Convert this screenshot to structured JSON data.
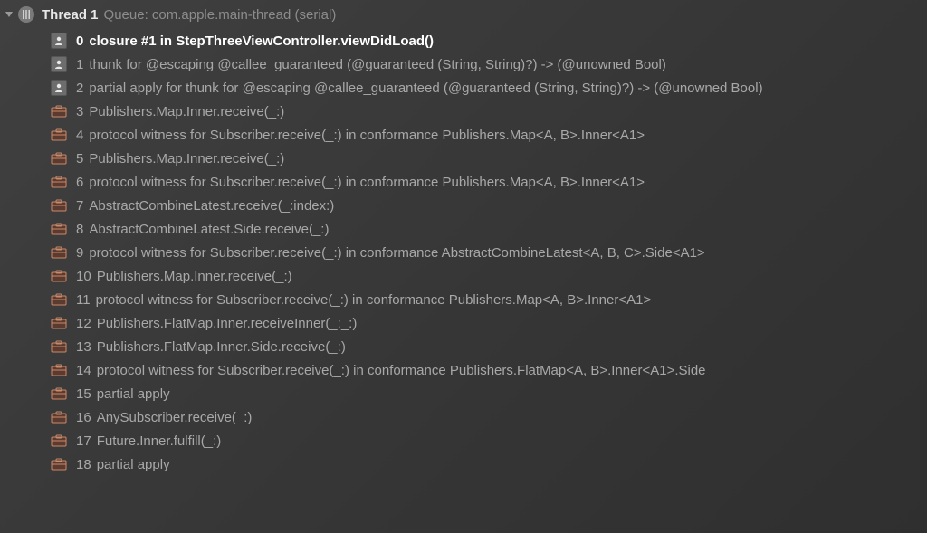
{
  "thread": {
    "title": "Thread 1",
    "queue": "Queue: com.apple.main-thread (serial)"
  },
  "frames": [
    {
      "num": "0",
      "label": "closure #1 in StepThreeViewController.viewDidLoad()",
      "icon": "person",
      "selected": true
    },
    {
      "num": "1",
      "label": "thunk for @escaping @callee_guaranteed (@guaranteed (String, String)?) -> (@unowned Bool)",
      "icon": "person",
      "selected": false
    },
    {
      "num": "2",
      "label": "partial apply for thunk for @escaping @callee_guaranteed (@guaranteed (String, String)?) -> (@unowned Bool)",
      "icon": "person",
      "selected": false
    },
    {
      "num": "3",
      "label": "Publishers.Map.Inner.receive(_:)",
      "icon": "briefcase",
      "selected": false
    },
    {
      "num": "4",
      "label": "protocol witness for Subscriber.receive(_:) in conformance Publishers.Map<A, B>.Inner<A1>",
      "icon": "briefcase",
      "selected": false
    },
    {
      "num": "5",
      "label": "Publishers.Map.Inner.receive(_:)",
      "icon": "briefcase",
      "selected": false
    },
    {
      "num": "6",
      "label": "protocol witness for Subscriber.receive(_:) in conformance Publishers.Map<A, B>.Inner<A1>",
      "icon": "briefcase",
      "selected": false
    },
    {
      "num": "7",
      "label": "AbstractCombineLatest.receive(_:index:)",
      "icon": "briefcase",
      "selected": false
    },
    {
      "num": "8",
      "label": "AbstractCombineLatest.Side.receive(_:)",
      "icon": "briefcase",
      "selected": false
    },
    {
      "num": "9",
      "label": "protocol witness for Subscriber.receive(_:) in conformance AbstractCombineLatest<A, B, C>.Side<A1>",
      "icon": "briefcase",
      "selected": false
    },
    {
      "num": "10",
      "label": "Publishers.Map.Inner.receive(_:)",
      "icon": "briefcase",
      "selected": false
    },
    {
      "num": "11",
      "label": "protocol witness for Subscriber.receive(_:) in conformance Publishers.Map<A, B>.Inner<A1>",
      "icon": "briefcase",
      "selected": false
    },
    {
      "num": "12",
      "label": "Publishers.FlatMap.Inner.receiveInner(_:_:)",
      "icon": "briefcase",
      "selected": false
    },
    {
      "num": "13",
      "label": "Publishers.FlatMap.Inner.Side.receive(_:)",
      "icon": "briefcase",
      "selected": false
    },
    {
      "num": "14",
      "label": "protocol witness for Subscriber.receive(_:) in conformance Publishers.FlatMap<A, B>.Inner<A1>.Side",
      "icon": "briefcase",
      "selected": false
    },
    {
      "num": "15",
      "label": "partial apply",
      "icon": "briefcase",
      "selected": false
    },
    {
      "num": "16",
      "label": "AnySubscriber.receive(_:)",
      "icon": "briefcase",
      "selected": false
    },
    {
      "num": "17",
      "label": "Future.Inner.fulfill(_:)",
      "icon": "briefcase",
      "selected": false
    },
    {
      "num": "18",
      "label": "partial apply",
      "icon": "briefcase",
      "selected": false
    }
  ]
}
